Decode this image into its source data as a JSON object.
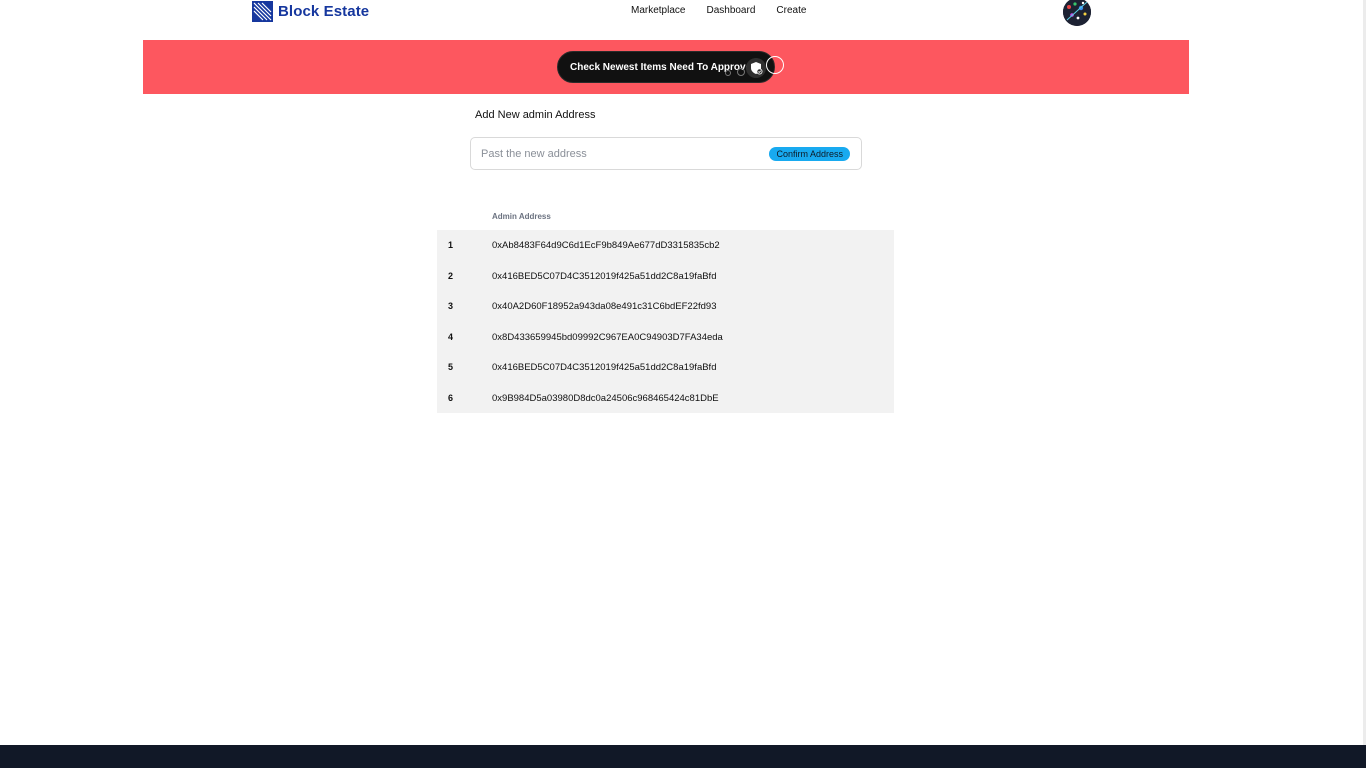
{
  "header": {
    "brand": "Block Estate",
    "brand_color": "#16379e",
    "logo_icon": "block-estate-logo-icon",
    "nav": [
      "Marketplace",
      "Dashboard",
      "Create"
    ],
    "avatar_icon": "user-avatar"
  },
  "banner": {
    "background": "#fd575f",
    "approve_label": "Check Newest Items Need To Approve",
    "approve_icon": "shield-check-icon"
  },
  "admin_form": {
    "title": "Add New admin Address",
    "input_placeholder": "Past the new address",
    "input_value": "",
    "confirm_label": "Confirm Address",
    "confirm_color": "#18aaf0"
  },
  "admin_table": {
    "column_header": "Admin Address",
    "rows": [
      {
        "index": "1",
        "address": "0xAb8483F64d9C6d1EcF9b849Ae677dD3315835cb2"
      },
      {
        "index": "2",
        "address": "0x416BED5C07D4C3512019f425a51dd2C8a19faBfd"
      },
      {
        "index": "3",
        "address": "0x40A2D60F18952a943da08e491c31C6bdEF22fd93"
      },
      {
        "index": "4",
        "address": "0x8D433659945bd09992C967EA0C94903D7FA34eda"
      },
      {
        "index": "5",
        "address": "0x416BED5C07D4C3512019f425a51dd2C8a19faBfd"
      },
      {
        "index": "6",
        "address": "0x9B984D5a03980D8dc0a24506c968465424c81DbE"
      }
    ]
  },
  "footer": {
    "background": "#111827"
  }
}
